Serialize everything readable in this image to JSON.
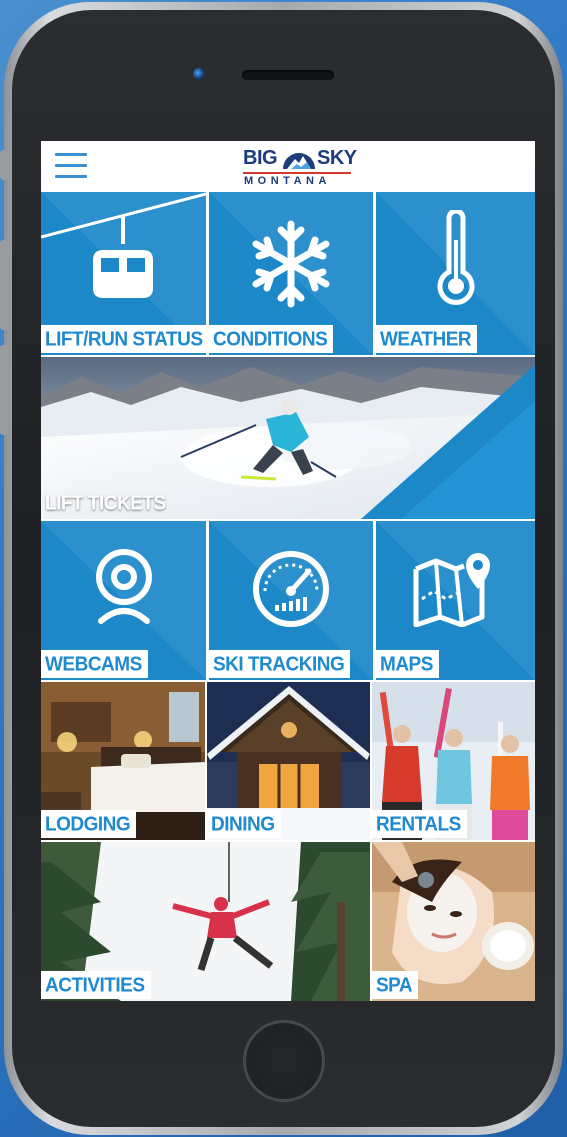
{
  "header": {
    "logo_big": "BIG",
    "logo_sky": "SKY",
    "logo_sub": "MONTANA"
  },
  "tiles": {
    "lift_run_status": "LIFT/RUN STATUS",
    "conditions": "CONDITIONS",
    "weather": "WEATHER",
    "lift_tickets": "LIFT TICKETS",
    "webcams": "WEBCAMS",
    "ski_tracking": "SKI TRACKING",
    "maps": "MAPS",
    "lodging": "LODGING",
    "dining": "DINING",
    "rentals": "RENTALS",
    "activities": "ACTIVITIES",
    "spa": "SPA"
  },
  "colors": {
    "brand_blue": "#1c88c8",
    "label_text": "#1f8ad0",
    "logo_navy": "#1d3d7a",
    "logo_red": "#d23a2f"
  }
}
